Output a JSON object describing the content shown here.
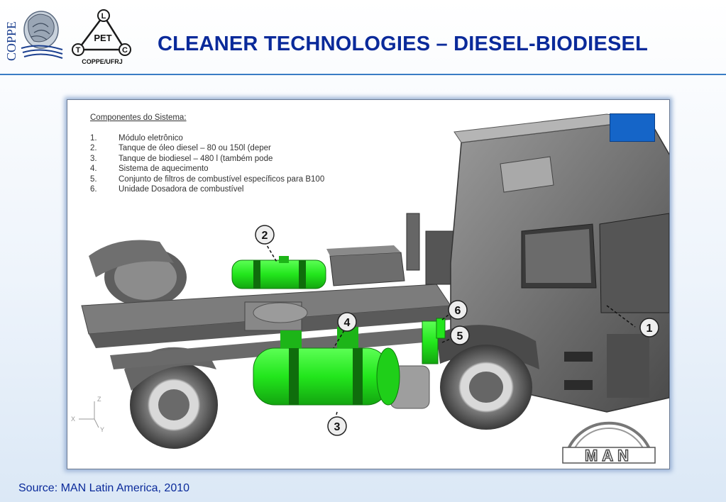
{
  "title": "CLEANER TECHNOLOGIES – DIESEL-BIODIESEL",
  "logos": {
    "coppe_text": "COPPE",
    "pet_text": "PET",
    "pet_l": "L",
    "pet_t": "T",
    "pet_c": "C",
    "pet_caption": "COPPE/UFRJ",
    "man_text": "MAN"
  },
  "components": {
    "heading": "Componentes do Sistema:",
    "items": [
      {
        "num": "1.",
        "text": "Módulo eletrônico"
      },
      {
        "num": "2.",
        "text": "Tanque de óleo diesel – 80 ou 150l (deper"
      },
      {
        "num": "3.",
        "text": "Tanque de biodiesel – 480 l (também pode"
      },
      {
        "num": "4.",
        "text": "Sistema de aquecimento"
      },
      {
        "num": "5.",
        "text": "Conjunto de filtros de combustível específicos para B100"
      },
      {
        "num": "6.",
        "text": "Unidade Dosadora de combustível"
      }
    ]
  },
  "callouts": [
    "1",
    "2",
    "3",
    "4",
    "5",
    "6"
  ],
  "axes": {
    "z": "Z",
    "x": "X",
    "y": "Y"
  },
  "source": "Source: MAN Latin America, 2010",
  "colors": {
    "highlight": "#22e61c",
    "title": "#0a2a9a",
    "accent_box": "#1565c8"
  }
}
